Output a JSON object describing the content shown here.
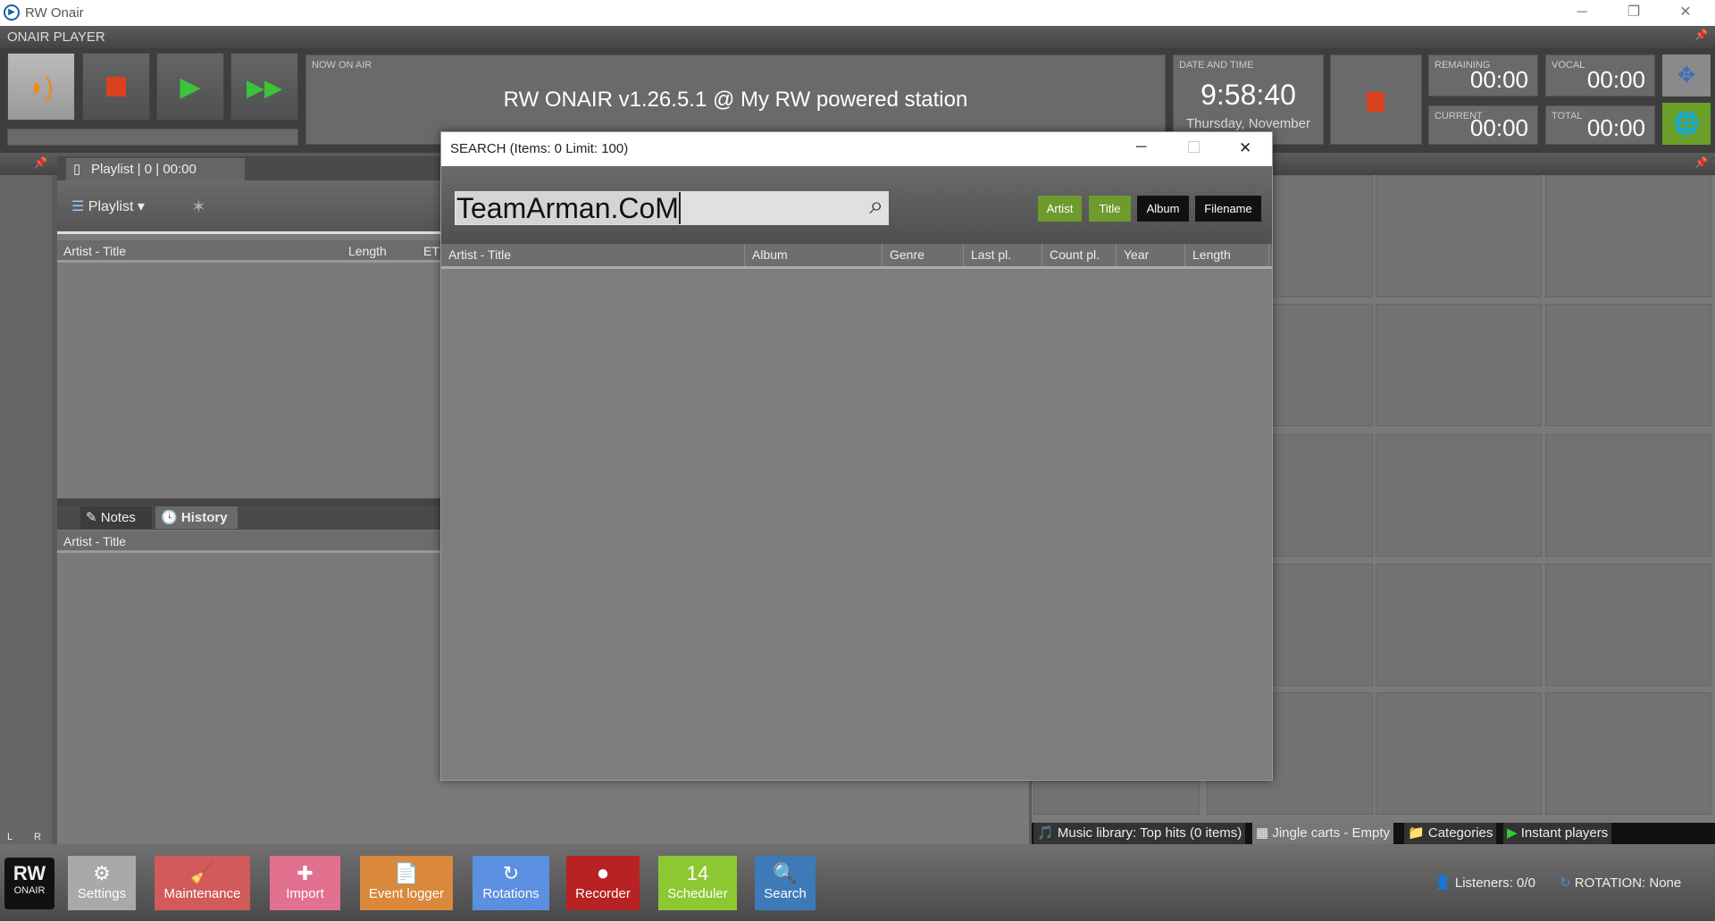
{
  "window": {
    "title": "RW Onair",
    "min": "─",
    "restore": "❐",
    "close": "✕"
  },
  "player": {
    "section_title": "ONAIR PLAYER",
    "now_on_air_label": "NOW ON AIR",
    "now_on_air_text": "RW ONAIR v1.26.5.1 @ My RW powered station",
    "date_label": "DATE AND TIME",
    "time": "9:58:40",
    "date": "Thursday, November",
    "remaining_label": "REMAINING",
    "remaining": "00:00",
    "vocal_label": "VOCAL",
    "vocal": "00:00",
    "current_label": "CURRENT",
    "current": "00:00",
    "total_label": "TOTAL",
    "total": "00:00"
  },
  "playlist": {
    "tab": "Playlist | 0 | 00:00",
    "menu": "Playlist",
    "columns": [
      "Artist - Title",
      "Length",
      "ET"
    ]
  },
  "lower": {
    "tabs": [
      "Notes",
      "History"
    ],
    "active": "History",
    "column": "Artist - Title",
    "lr": [
      "L",
      "R"
    ]
  },
  "library_tabs": [
    "Music library: Top hits (0 items)",
    "Jingle carts - Empty",
    "Categories",
    "Instant players"
  ],
  "toolbar": {
    "logo_top": "RW",
    "logo_bottom": "ONAIR",
    "buttons": [
      {
        "label": "Settings",
        "color": "#a9a9a9",
        "icon": "⚙"
      },
      {
        "label": "Maintenance",
        "color": "#d25a5a",
        "icon": "🧹"
      },
      {
        "label": "Import",
        "color": "#e2708f",
        "icon": "✚"
      },
      {
        "label": "Event logger",
        "color": "#d9883c",
        "icon": "📄"
      },
      {
        "label": "Rotations",
        "color": "#5b90e0",
        "icon": "↻"
      },
      {
        "label": "Recorder",
        "color": "#b82222",
        "icon": "⏺"
      },
      {
        "label": "Scheduler",
        "color": "#8cc832",
        "icon": "14"
      },
      {
        "label": "Search",
        "color": "#3e7ab8",
        "icon": "🔍"
      }
    ]
  },
  "status": {
    "listeners": "Listeners: 0/0",
    "rotation": "ROTATION: None"
  },
  "search_dialog": {
    "title": "SEARCH (Items: 0 Limit: 100)",
    "query": "TeamArman.CoM",
    "filters": [
      {
        "label": "Artist",
        "active": true
      },
      {
        "label": "Title",
        "active": true
      },
      {
        "label": "Album",
        "active": false
      },
      {
        "label": "Filename",
        "active": false
      }
    ],
    "columns": [
      "Artist - Title",
      "Album",
      "Genre",
      "Last pl.",
      "Count pl.",
      "Year",
      "Length"
    ]
  },
  "colors": {
    "active_filter": "#6e9a2e",
    "inactive_filter": "#111111"
  }
}
